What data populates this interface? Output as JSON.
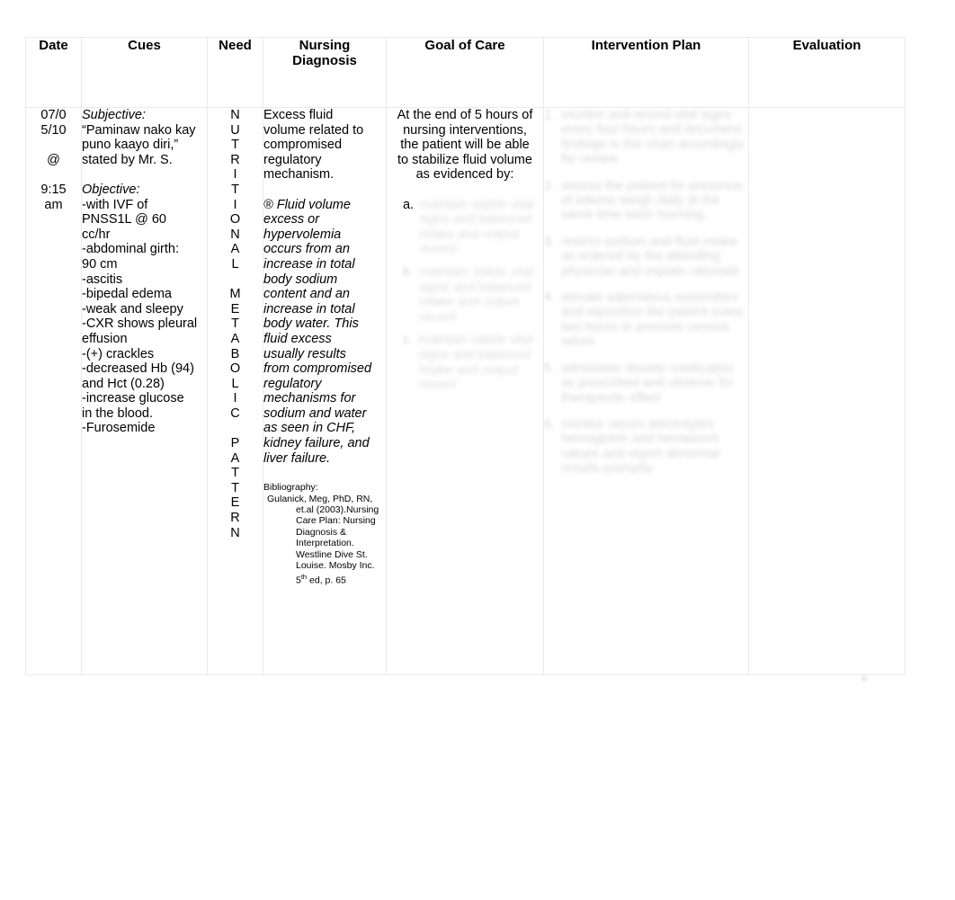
{
  "table": {
    "headers": [
      {
        "id": "date",
        "label": "Date"
      },
      {
        "id": "cues",
        "label": "Cues"
      },
      {
        "id": "need",
        "label": "Need"
      },
      {
        "id": "diagnosis",
        "label": "Nursing\nDiagnosis",
        "line1": "Nursing",
        "line2": "Diagnosis"
      },
      {
        "id": "goal",
        "label": "Goal of Care"
      },
      {
        "id": "intervention",
        "label": "Intervention Plan"
      },
      {
        "id": "evaluation",
        "label": "Evaluation"
      }
    ],
    "row": {
      "date": {
        "lines": [
          "07/0",
          "5/10",
          "",
          "@",
          "",
          "9:15",
          "am"
        ]
      },
      "cues": {
        "subjective_label": "Subjective:",
        "subjective_lines": [
          "“Paminaw nako kay",
          "puno kaayo diri,”",
          "stated by Mr. S."
        ],
        "objective_label": "Objective:",
        "objective_lines": [
          "-with IVF of",
          "PNSS1L @ 60",
          "cc/hr",
          "-abdominal girth:",
          "90 cm",
          "-ascitis",
          "-bipedal edema",
          "-weak and sleepy",
          "-CXR shows pleural",
          "effusion",
          "-(+) crackles",
          "-decreased Hb (94)",
          " and Hct (0.28)",
          "-increase glucose",
          "in the blood.",
          "-Furosemide"
        ]
      },
      "need": {
        "full_text": "NUTRITIONAL METABOLIC PATTERN",
        "letters": [
          "N",
          "U",
          "T",
          "R",
          "I",
          "T",
          "I",
          "O",
          "N",
          "A",
          "L",
          "",
          "M",
          "E",
          "T",
          "A",
          "B",
          "O",
          "L",
          "I",
          "C",
          "",
          "P",
          "A",
          "T",
          "T",
          "E",
          "R",
          "N"
        ]
      },
      "diagnosis": {
        "statement_lines": [
          "Excess fluid",
          "volume related to",
          "compromised",
          "regulatory",
          "mechanism."
        ],
        "rationale_marker": "®",
        "rationale_lines": [
          "Fluid volume",
          "excess or",
          "hypervolemia",
          "occurs from an",
          "increase in total",
          "body sodium",
          "content and an",
          "increase in total",
          "body water. This",
          "fluid excess",
          "usually results",
          "from compromised",
          "regulatory",
          "mechanisms for",
          "sodium and water",
          "as seen in CHF,",
          "kidney failure, and",
          "liver failure."
        ],
        "bibliography": {
          "title": "Bibliography:",
          "author_line": "Gulanick, Meg, PhD, RN,",
          "continuation_lines": [
            "et.al (2003).Nursing",
            "Care Plan: Nursing",
            "Diagnosis &",
            "Interpretation.",
            "Westline Dive St.",
            "Louise. Mosby Inc."
          ],
          "edition_prefix": "5",
          "edition_sup": "th",
          "edition_suffix": " ed, p. 65"
        }
      },
      "goal": {
        "statement_lines": [
          "At the end of 5 hours of",
          "nursing interventions,",
          "the patient will be able",
          "to stabilize fluid volume",
          "as evidenced by:"
        ],
        "items": [
          {
            "marker": "a.",
            "marker_visible": true,
            "text": "[obscured]"
          },
          {
            "marker": "b.",
            "marker_visible": false,
            "text": "[obscured]"
          },
          {
            "marker": "c.",
            "marker_visible": false,
            "text": "[obscured]"
          }
        ]
      },
      "intervention": {
        "items": [
          {
            "marker": "",
            "text": "[obscured]"
          },
          {
            "marker": "",
            "text": "[obscured]"
          },
          {
            "marker": "",
            "text": "[obscured]"
          },
          {
            "marker": "",
            "text": "[obscured]"
          },
          {
            "marker": "",
            "text": "[obscured]"
          },
          {
            "marker": "",
            "text": "[obscured]"
          }
        ]
      },
      "evaluation": {
        "content": ""
      }
    }
  },
  "artifact": {
    "glyph": "▪"
  },
  "colors": {
    "background": "#ffffff",
    "text": "#000000",
    "border": "#ebebeb"
  }
}
